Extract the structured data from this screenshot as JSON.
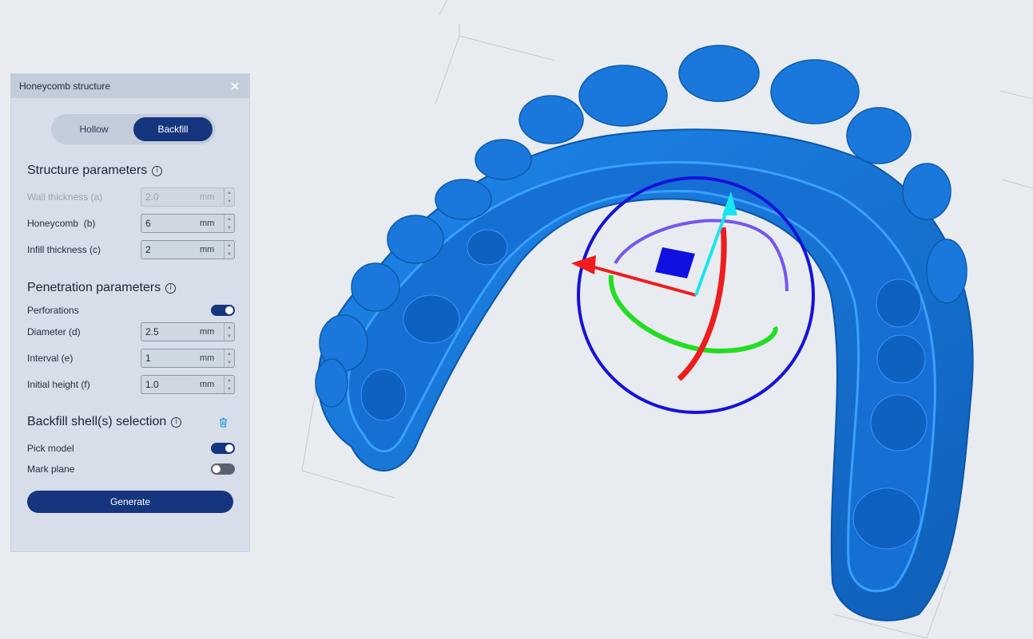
{
  "panel": {
    "title": "Honeycomb structure",
    "mode": {
      "options": [
        "Hollow",
        "Backfill"
      ],
      "selected": "Backfill"
    },
    "structure": {
      "heading": "Structure parameters",
      "wall": {
        "label": "Wall thickness (a)",
        "value": "2.0",
        "unit": "mm",
        "disabled": true
      },
      "honeycomb": {
        "label": "Honeycomb  (b)",
        "value": "6",
        "unit": "mm"
      },
      "infill": {
        "label": "Infill thickness (c)",
        "value": "2",
        "unit": "mm"
      }
    },
    "penetration": {
      "heading": "Penetration parameters",
      "perforations": {
        "label": "Perforations",
        "on": true
      },
      "diameter": {
        "label": "Diameter (d)",
        "value": "2.5",
        "unit": "mm"
      },
      "interval": {
        "label": "Interval (e)",
        "value": "1",
        "unit": "mm"
      },
      "initial_height": {
        "label": "Initial height (f)",
        "value": "1.0",
        "unit": "mm"
      }
    },
    "backfill": {
      "heading": "Backfill shell(s) selection",
      "pick_model": {
        "label": "Pick model",
        "on": true
      },
      "mark_plane": {
        "label": "Mark plane",
        "on": false
      }
    },
    "generate_label": "Generate"
  },
  "icons": {
    "close": "close-icon",
    "info": "info-icon",
    "trash": "trash-icon"
  },
  "colors": {
    "accent": "#16357f",
    "model": "#1a7fe0",
    "gizmo_x": "#ee1c1c",
    "gizmo_y": "#22dd22",
    "gizmo_z": "#17e6f0",
    "gizmo_ring": "#1412d8"
  }
}
